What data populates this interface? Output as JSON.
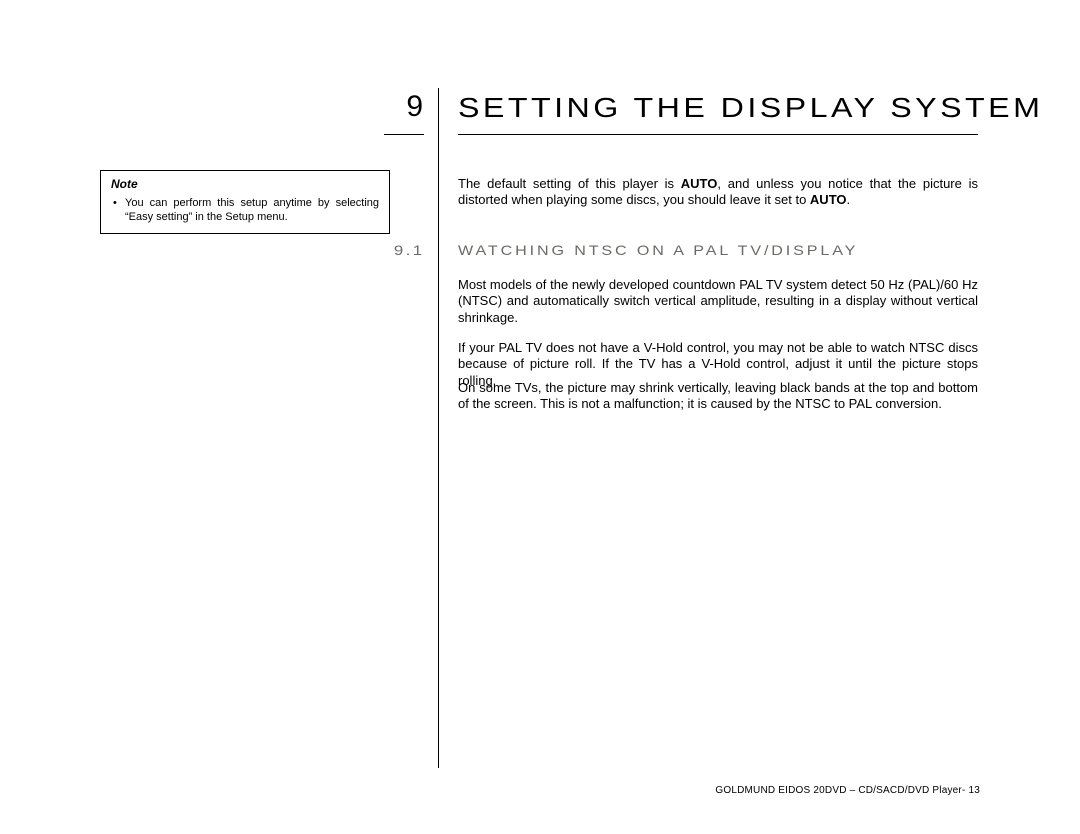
{
  "chapter": {
    "number": "9",
    "title": "SETTING THE DISPLAY SYSTEM"
  },
  "note": {
    "heading": "Note",
    "bullet": "•",
    "text": "You can perform this setup anytime by selecting “Easy setting” in the Setup menu."
  },
  "intro": {
    "before_bold1": "The default setting of this player is ",
    "bold1": "AUTO",
    "middle": ", and unless you notice that the picture is distorted when playing some discs, you should leave it set to ",
    "bold2": "AUTO",
    "after_bold2": "."
  },
  "subsection": {
    "number": "9.1",
    "title": "WATCHING NTSC ON A PAL TV/DISPLAY"
  },
  "paragraphs": {
    "p2": "Most models of the newly developed countdown PAL TV system detect 50 Hz (PAL)/60 Hz (NTSC) and automatically switch vertical amplitude, resulting in a display without vertical shrinkage.",
    "p3": "If your PAL TV does not have a V-Hold control, you may not be able to watch NTSC discs because of picture roll. If the TV has a V-Hold control, adjust it until the picture stops rolling.",
    "p4": "On some TVs, the picture may shrink vertically, leaving black bands at the top and bottom of the screen. This is not a malfunction; it is caused by the NTSC to PAL conversion."
  },
  "footer": "GOLDMUND EIDOS 20DVD – CD/SACD/DVD Player- 13"
}
